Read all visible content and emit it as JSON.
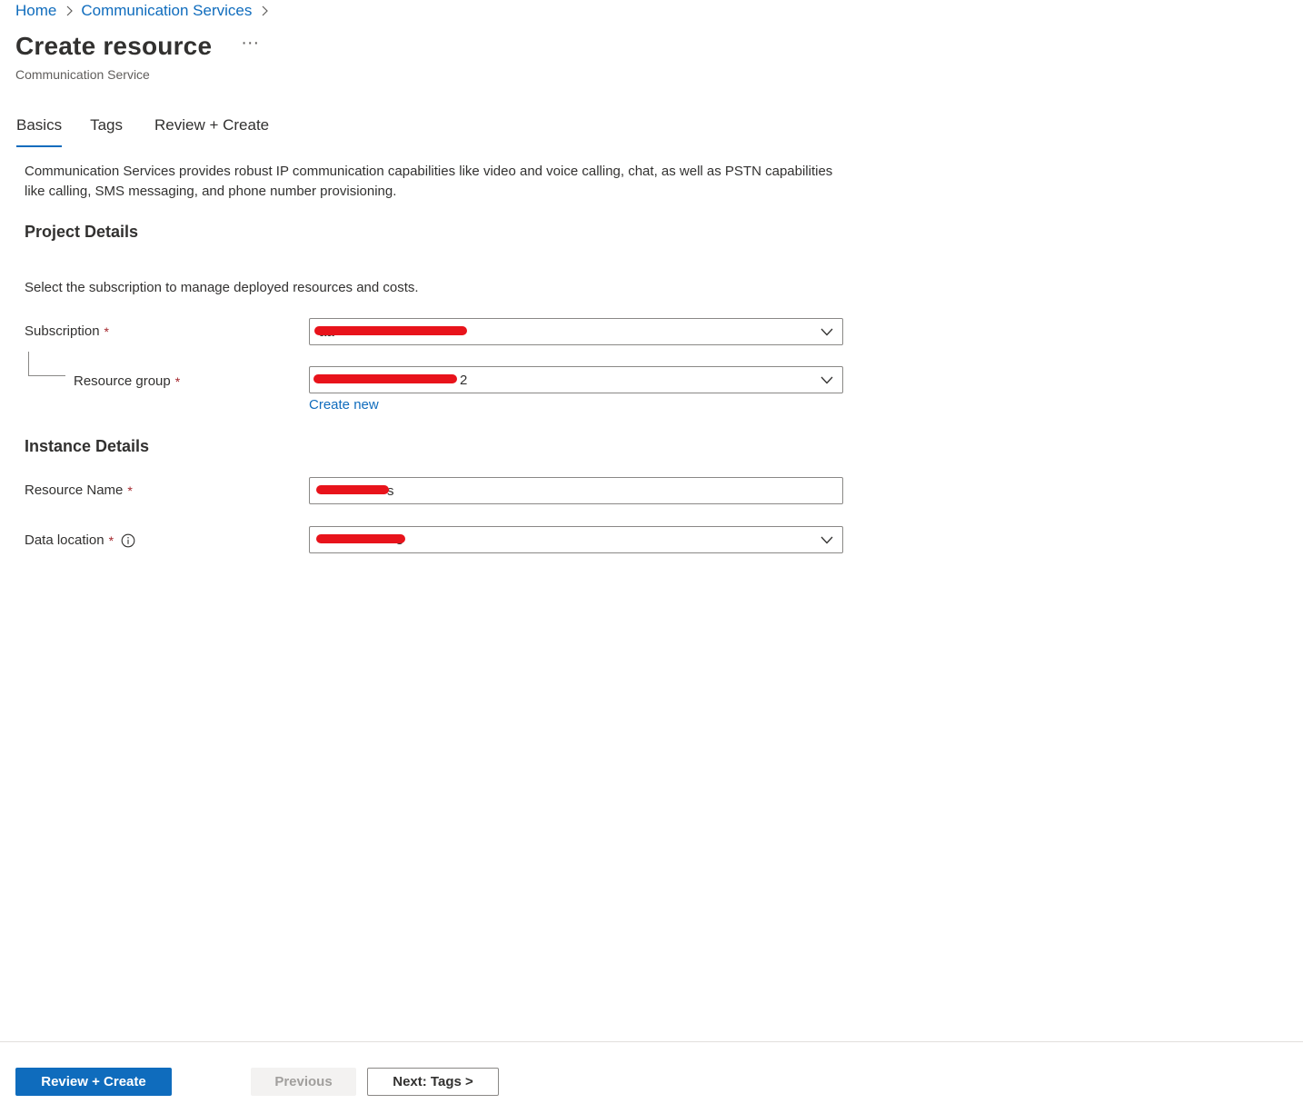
{
  "breadcrumb": {
    "items": [
      "Home",
      "Communication Services"
    ]
  },
  "header": {
    "title": "Create resource",
    "more": "···",
    "subtitle": "Communication Service"
  },
  "tabs": [
    {
      "label": "Basics",
      "active": true
    },
    {
      "label": "Tags",
      "active": false
    },
    {
      "label": "Review + Create",
      "active": false
    }
  ],
  "intro": "Communication Services provides robust IP communication capabilities like video and voice calling, chat, as well as PSTN capabilities like calling, SMS messaging, and phone number provisioning.",
  "project_details": {
    "heading": "Project Details",
    "helper": "Select the subscription to manage deployed resources and costs.",
    "subscription": {
      "label": "Subscription",
      "required_mark": "*",
      "value": "aa",
      "redacted": true
    },
    "resource_group": {
      "label": "Resource group",
      "required_mark": "*",
      "value": "2",
      "redacted": true
    },
    "create_new": "Create new"
  },
  "instance_details": {
    "heading": "Instance Details",
    "resource_name": {
      "label": "Resource Name",
      "required_mark": "*",
      "value": "s",
      "redacted": true
    },
    "data_location": {
      "label": "Data location",
      "required_mark": "*",
      "value": "s",
      "redacted": true
    }
  },
  "footer": {
    "review_create": "Review + Create",
    "previous": "Previous",
    "next": "Next: Tags >"
  },
  "colors": {
    "accent": "#0f6cbd",
    "required": "#a4262c",
    "redaction": "#e8131b",
    "disabled_bg": "#f3f2f1"
  },
  "icons": [
    "chevron-right-icon",
    "chevron-down-icon",
    "info-icon",
    "more-icon"
  ]
}
